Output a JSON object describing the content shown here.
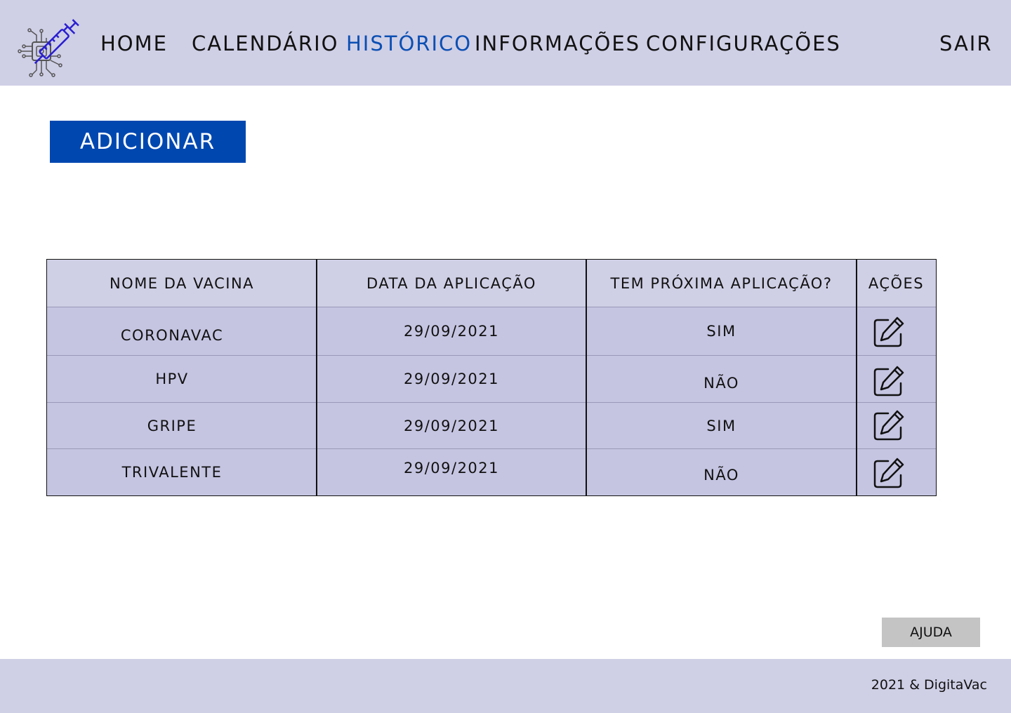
{
  "header": {
    "logo_icon": "syringe-chip-icon",
    "nav": [
      {
        "label": "HOME",
        "active": false
      },
      {
        "label": "CALENDÁRIO",
        "active": false
      },
      {
        "label": "HISTÓRICO",
        "active": true
      },
      {
        "label": "INFORMAÇÕES",
        "active": false
      },
      {
        "label": "CONFIGURAÇÕES",
        "active": false
      }
    ],
    "logout_label": "SAIR"
  },
  "actions": {
    "add_label": "ADICIONAR"
  },
  "table": {
    "columns": [
      "NOME DA VACINA",
      "DATA DA APLICAÇÃO",
      "TEM PRÓXIMA APLICAÇÃO?",
      "AÇÕES"
    ],
    "rows": [
      {
        "name": "CORONAVAC",
        "date": "29/09/2021",
        "next": "SIM",
        "action_icon": "edit-icon"
      },
      {
        "name": "HPV",
        "date": "29/09/2021",
        "next": "NÃO",
        "action_icon": "edit-icon"
      },
      {
        "name": "GRIPE",
        "date": "29/09/2021",
        "next": "SIM",
        "action_icon": "edit-icon"
      },
      {
        "name": "TRIVALENTE",
        "date": "29/09/2021",
        "next": "NÃO",
        "action_icon": "edit-icon"
      }
    ]
  },
  "help_label": "AJUDA",
  "footer": {
    "copyright": "2021 & DigitaVac"
  },
  "colors": {
    "header_bg": "#cfcfe6",
    "accent": "#0047b0",
    "active_nav": "#0b4fb3",
    "table_body": "#c5c5e2"
  }
}
